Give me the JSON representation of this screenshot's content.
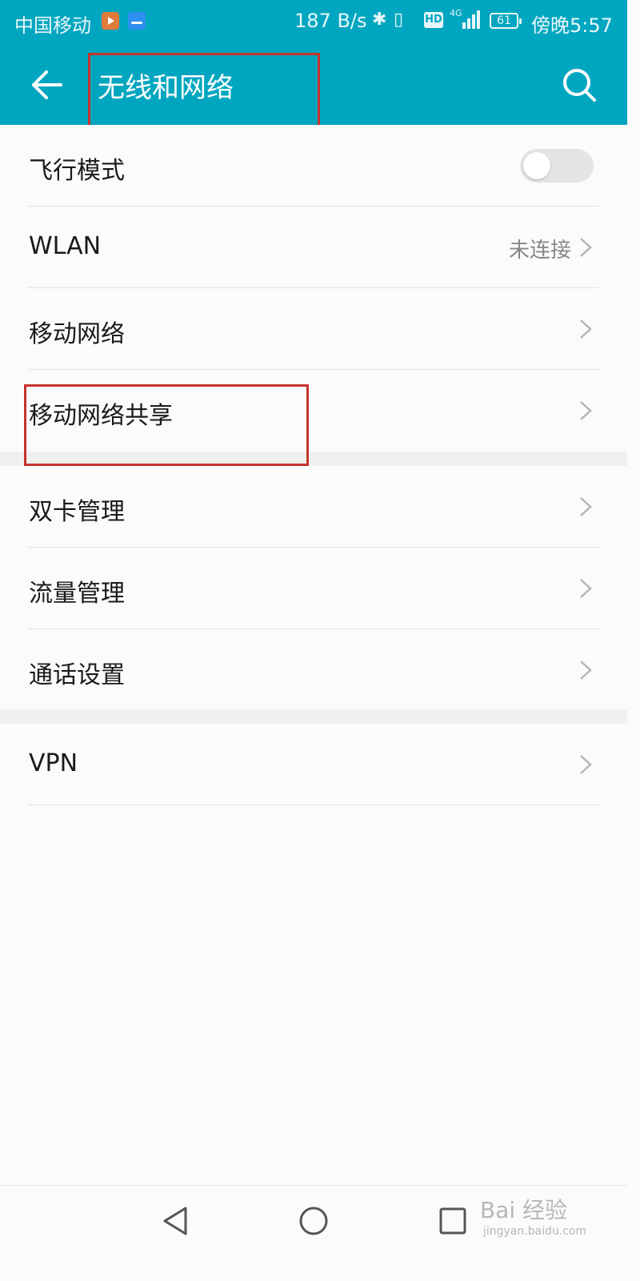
{
  "status_bar": {
    "carrier": "中国移动",
    "net_speed": "187 B/s",
    "hd_badge": "HD",
    "network_type": "4G",
    "battery_level": "61",
    "time": "傍晚5:57"
  },
  "header": {
    "title": "无线和网络",
    "back_icon": "arrow-left-icon",
    "search_icon": "search-icon"
  },
  "sections": [
    {
      "items": [
        {
          "label": "飞行模式",
          "type": "toggle",
          "on": false
        },
        {
          "label": "WLAN",
          "type": "link",
          "value": "未连接"
        },
        {
          "label": "移动网络",
          "type": "link"
        },
        {
          "label": "移动网络共享",
          "type": "link"
        }
      ]
    },
    {
      "items": [
        {
          "label": "双卡管理",
          "type": "link"
        },
        {
          "label": "流量管理",
          "type": "link"
        },
        {
          "label": "通话设置",
          "type": "link"
        }
      ]
    },
    {
      "items": [
        {
          "label": "VPN",
          "type": "link"
        }
      ]
    }
  ],
  "watermark": {
    "text": "Bai 经验",
    "sub": "jingyan.baidu.com"
  },
  "colors": {
    "accent": "#00a6c0",
    "highlight_box": "#c8322e"
  }
}
